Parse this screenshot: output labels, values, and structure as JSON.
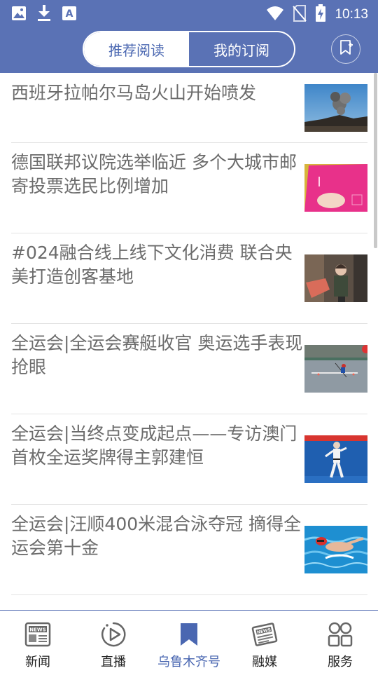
{
  "status_bar": {
    "time": "10:13",
    "left_icons": [
      "gallery-icon",
      "download-icon",
      "font-a-icon"
    ],
    "right_icons": [
      "wifi-icon",
      "no-sim-icon",
      "battery-charging-icon"
    ]
  },
  "header": {
    "tabs": [
      {
        "label": "推荐阅读",
        "active": false
      },
      {
        "label": "我的订阅",
        "active": true
      }
    ],
    "action_icon": "bookmark-add-icon"
  },
  "articles": [
    {
      "title": "西班牙拉帕尔马岛火山开始喷发",
      "thumb": "volcano-eruption-photo"
    },
    {
      "title": "德国联邦议院选举临近 多个大城市邮寄投票选民比例增加",
      "thumb": "postal-ballot-photo"
    },
    {
      "title": "#024融合线上线下文化消费 联合央美打造创客基地",
      "thumb": "studio-portrait-photo"
    },
    {
      "title": "全运会|全运会赛艇收官 奥运选手表现抢眼",
      "thumb": "rowing-photo"
    },
    {
      "title": "全运会|当终点变成起点——专访澳门首枚全运奖牌得主郭建恒",
      "thumb": "martial-arts-photo"
    },
    {
      "title": "全运会|汪顺400米混合泳夺冠 摘得全运会第十金",
      "thumb": "swimming-photo"
    }
  ],
  "tabbar": {
    "items": [
      {
        "label": "新闻",
        "icon": "newspaper-icon",
        "active": false
      },
      {
        "label": "直播",
        "icon": "play-circle-icon",
        "active": false
      },
      {
        "label": "乌鲁木齐号",
        "icon": "bookmark-icon",
        "active": true
      },
      {
        "label": "融媒",
        "icon": "media-news-icon",
        "active": false
      },
      {
        "label": "服务",
        "icon": "services-grid-icon",
        "active": false
      }
    ]
  },
  "colors": {
    "header_bg": "#5a72b5",
    "accent": "#4a67b1",
    "title_text": "#6b6b6b",
    "divider": "#e3e3e3"
  }
}
